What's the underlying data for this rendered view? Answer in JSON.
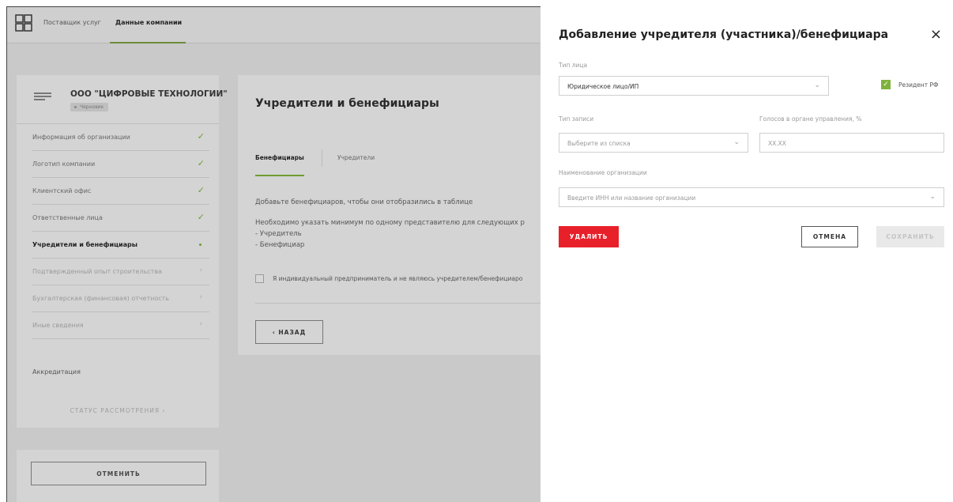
{
  "nav": {
    "provider": "Поставщик услуг",
    "company_data": "Данные компании"
  },
  "company": {
    "name": "ООО \"ЦИФРОВЫЕ ТЕХНОЛОГИИ\"",
    "status": "Черновик"
  },
  "sidebar": {
    "items": [
      {
        "label": "Информация об организации",
        "state": "done"
      },
      {
        "label": "Логотип компании",
        "state": "done"
      },
      {
        "label": "Клиентский офис",
        "state": "done"
      },
      {
        "label": "Ответственные лица",
        "state": "done"
      },
      {
        "label": "Учредители и бенефициары",
        "state": "active"
      },
      {
        "label": "Подтвержденный опыт строительства",
        "state": "disabled"
      },
      {
        "label": "Бухгалтерская (финансовая) отчетность",
        "state": "disabled"
      },
      {
        "label": "Иные сведения",
        "state": "disabled"
      }
    ],
    "accreditation": "Аккредитация",
    "status_link": "СТАТУС РАССМОТРЕНИЯ  ›",
    "cancel": "ОТМЕНИТЬ"
  },
  "main": {
    "title": "Учредители и бенефициары",
    "tabs": [
      "Бенефициары",
      "Учредители"
    ],
    "hint": "Добавьте бенефициаров, чтобы они отобразились в таблице",
    "requirement": "Необходимо указать минимум по одному представителю для следующих р",
    "req_items": [
      "- Учредитель",
      "- Бенефициар"
    ],
    "checkbox_label": "Я индивидуальный предприниматель и не являюсь учредителем/бенефициаро",
    "back": "‹  НАЗАД"
  },
  "drawer": {
    "title": "Добавление учредителя (участника)/бенефициара",
    "close": "×",
    "person_type_label": "Тип лица",
    "person_type_value": "Юридическое лицо/ИП",
    "resident_label": "Резидент РФ",
    "record_type_label": "Тип записи",
    "record_type_placeholder": "Выберите из списка",
    "votes_label": "Голосов в органе управления, %",
    "votes_placeholder": "XX.XX",
    "org_name_label": "Наименование организации",
    "org_name_placeholder": "Введите ИНН или название организации",
    "delete": "УДАЛИТЬ",
    "cancel": "ОТМЕНА",
    "save": "СОХРАНИТЬ"
  },
  "colors": {
    "accent_green": "#6f9c31",
    "danger_red": "#e8202a",
    "overlay_gray": "#c9c9c9"
  }
}
